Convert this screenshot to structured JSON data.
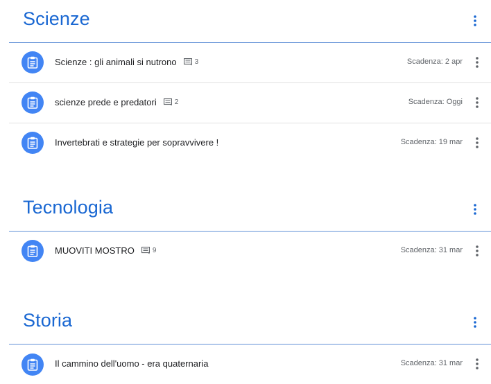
{
  "topics": [
    {
      "title": "Scienze",
      "items": [
        {
          "title": "Scienze : gli animali si nutrono",
          "comments": "3",
          "due": "Scadenza: 2 apr"
        },
        {
          "title": "scienze prede e predatori",
          "comments": "2",
          "due": "Scadenza: Oggi"
        },
        {
          "title": "Invertebrati e strategie per sopravvivere !",
          "comments": "",
          "due": "Scadenza: 19 mar"
        }
      ]
    },
    {
      "title": "Tecnologia",
      "items": [
        {
          "title": "MUOVITI MOSTRO",
          "comments": "9",
          "due": "Scadenza: 31 mar"
        }
      ]
    },
    {
      "title": "Storia",
      "items": [
        {
          "title": "Il cammino dell'uomo - era quaternaria",
          "comments": "",
          "due": "Scadenza: 31 mar"
        }
      ]
    }
  ],
  "icons": {
    "assignment": "assignment-icon",
    "comment": "comment-icon",
    "more": "more-vert-icon"
  },
  "colors": {
    "accent": "#1967d2",
    "icon_bg": "#4285f4",
    "rule": "#5f8fd6",
    "muted": "#5f6368"
  }
}
